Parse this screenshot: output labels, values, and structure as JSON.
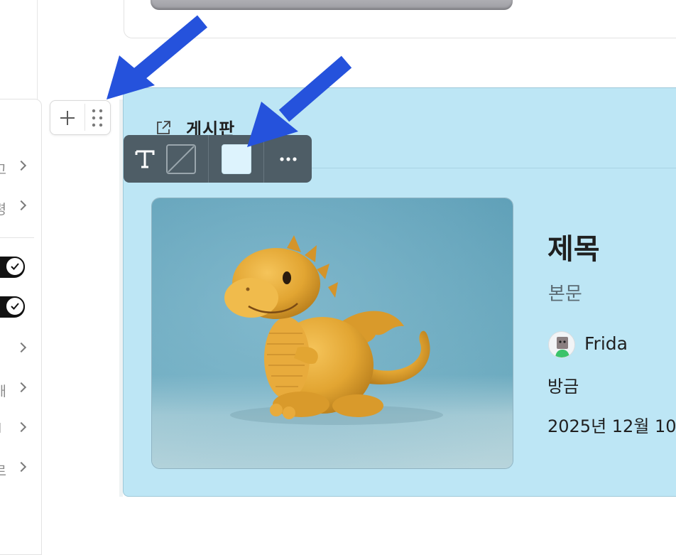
{
  "left_panel": {
    "rows": [
      {
        "char": "고"
      },
      {
        "char": "령"
      },
      {
        "char": ""
      },
      {
        "char": "개"
      },
      {
        "char": "l"
      },
      {
        "char": "르"
      }
    ]
  },
  "board": {
    "title": "게시판",
    "background_color": "#bde6f5"
  },
  "toolbar": {
    "icons": [
      "text-style-icon",
      "no-border-icon",
      "color-swatch",
      "more-icon"
    ],
    "selected_color": "#ddf3fd"
  },
  "post": {
    "title": "제목",
    "body": "본문",
    "author": "Frida",
    "time": "방금",
    "date": "2025년 12월 10"
  },
  "annotations": {
    "arrow_color": "#2552dc"
  }
}
